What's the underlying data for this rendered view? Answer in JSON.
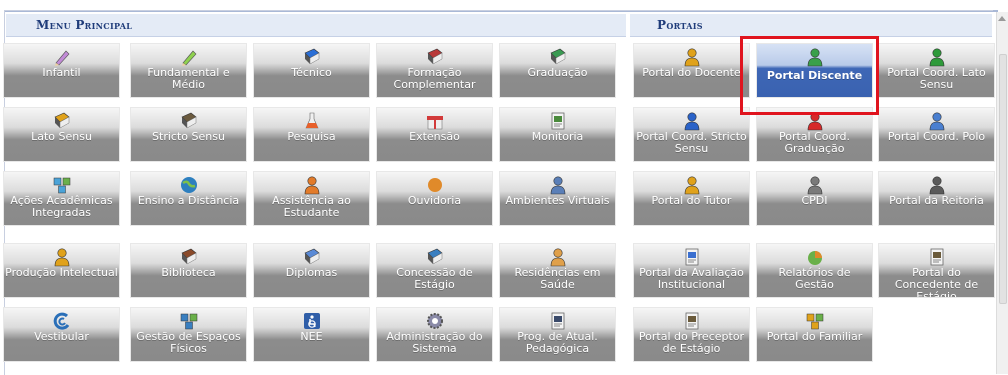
{
  "menu_principal": {
    "title": "Menu Principal",
    "tiles": [
      {
        "label": "Infantil",
        "icon": "crayons-icon",
        "color": "#c28bd6"
      },
      {
        "label": "Fundamental e Médio",
        "icon": "pencil-icon",
        "color": "#8fd14f"
      },
      {
        "label": "Técnico",
        "icon": "blue-book-icon",
        "color": "#2b6fd6"
      },
      {
        "label": "Formação Complementar",
        "icon": "red-book-icon",
        "color": "#b83a3a"
      },
      {
        "label": "Graduação",
        "icon": "books-stack-icon",
        "color": "#3a9a52"
      },
      {
        "label": "Lato Sensu",
        "icon": "folder-icon",
        "color": "#e0a21b"
      },
      {
        "label": "Stricto Sensu",
        "icon": "briefcase-icon",
        "color": "#6b5a3e"
      },
      {
        "label": "Pesquisa",
        "icon": "flask-icon",
        "color": "#e8602a"
      },
      {
        "label": "Extensão",
        "icon": "gift-box-icon",
        "color": "#d23a3a"
      },
      {
        "label": "Monitoria",
        "icon": "presentation-board-icon",
        "color": "#4a8a3c"
      },
      {
        "label": "Ações Acadêmicas Integradas",
        "icon": "puzzle-icon",
        "color": "#4aa3d8"
      },
      {
        "label": "Ensino a Distância",
        "icon": "globe-user-icon",
        "color": "#2d7fbf"
      },
      {
        "label": "Assistência ao Estudante",
        "icon": "user-help-icon",
        "color": "#e27b2a"
      },
      {
        "label": "Ouvidoria",
        "icon": "headset-user-icon",
        "color": "#e08a2a"
      },
      {
        "label": "Ambientes Virtuais",
        "icon": "users-group-icon",
        "color": "#5a7fb8"
      },
      {
        "label": "Produção Intelectual",
        "icon": "user-award-icon",
        "color": "#e0a21b"
      },
      {
        "label": "Biblioteca",
        "icon": "book-open-icon",
        "color": "#8a4a2a"
      },
      {
        "label": "Diplomas",
        "icon": "certificate-icon",
        "color": "#5a8ad6"
      },
      {
        "label": "Concessão de Estágio",
        "icon": "address-book-icon",
        "color": "#3a7fc0"
      },
      {
        "label": "Residências em Saúde",
        "icon": "doctor-icon",
        "color": "#e0a04a"
      },
      {
        "label": "Vestibular",
        "icon": "spiral-icon",
        "color": "#2a6fb8"
      },
      {
        "label": "Gestão de Espaços Físicos",
        "icon": "network-icon",
        "color": "#3a7fc0"
      },
      {
        "label": "NEE",
        "icon": "accessibility-icon",
        "color": "#2f5ea8"
      },
      {
        "label": "Administração do Sistema",
        "icon": "gear-icon",
        "color": "#8a8aa8"
      },
      {
        "label": "Prog. de Atual. Pedagógica",
        "icon": "monitor-teacher-icon",
        "color": "#3a4a6a"
      }
    ]
  },
  "portais": {
    "title": "Portais",
    "tiles": [
      {
        "label": "Portal do Docente",
        "icon": "user-orange-icon",
        "color": "#e0a21b"
      },
      {
        "label": "Portal Discente",
        "icon": "user-green-icon",
        "color": "#3aa04a",
        "selected": true
      },
      {
        "label": "Portal Coord. Lato Sensu",
        "icon": "user-green-icon",
        "color": "#2e9a3a"
      },
      {
        "label": "Portal Coord. Stricto Sensu",
        "icon": "user-blue-icon",
        "color": "#2a62c8"
      },
      {
        "label": "Portal Coord. Graduação",
        "icon": "user-red-icon",
        "color": "#d62a2a"
      },
      {
        "label": "Portal Coord. Polo",
        "icon": "user-tie-icon",
        "color": "#4a7fd0"
      },
      {
        "label": "Portal do Tutor",
        "icon": "user-tutor-icon",
        "color": "#e0a21b"
      },
      {
        "label": "CPDI",
        "icon": "user-suit-icon",
        "color": "#7a7a7a"
      },
      {
        "label": "Portal da Reitoria",
        "icon": "user-dark-suit-icon",
        "color": "#5a5a5a"
      },
      {
        "label": "Portal da Avaliação Institucional",
        "icon": "document-check-icon",
        "color": "#3a6fd0"
      },
      {
        "label": "Relatórios de Gestão",
        "icon": "pie-chart-icon",
        "color": "#e08a2a"
      },
      {
        "label": "Portal do Concedente de Estágio",
        "icon": "contact-card-icon",
        "color": "#6a5a3a"
      },
      {
        "label": "Portal do Preceptor de Estágio",
        "icon": "contact-card-icon",
        "color": "#6a5a3a"
      },
      {
        "label": "Portal do Familiar",
        "icon": "family-icon",
        "color": "#e0a21b"
      }
    ]
  }
}
